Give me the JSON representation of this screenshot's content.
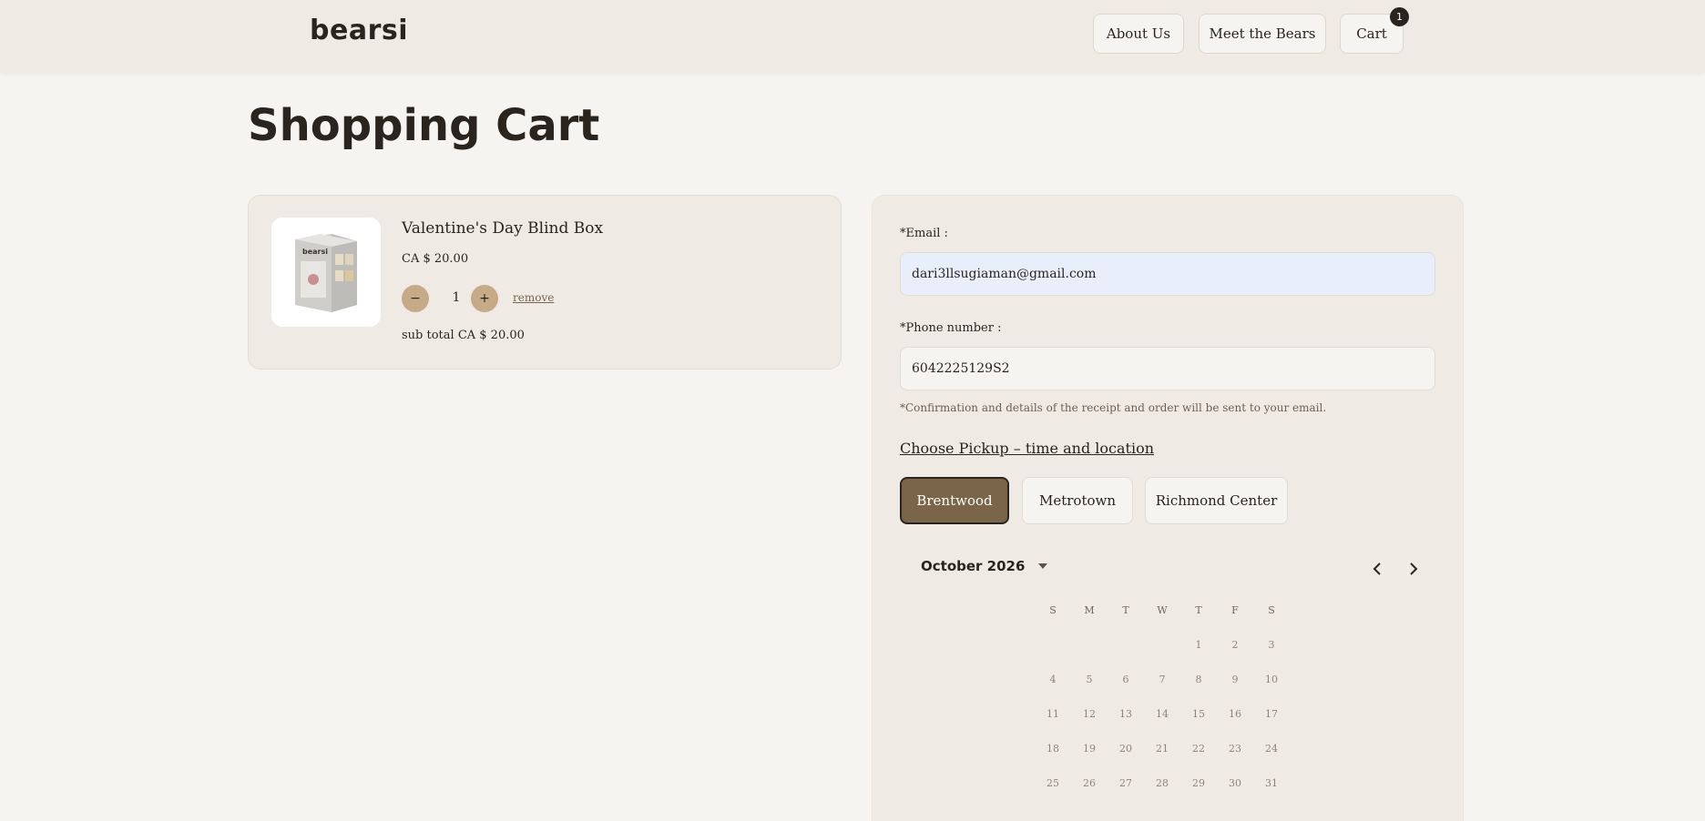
{
  "header": {
    "logo": "bearsi",
    "nav": {
      "about": "About Us",
      "bears": "Meet the Bears",
      "cart": "Cart",
      "cart_count": "1"
    }
  },
  "page": {
    "title": "Shopping Cart"
  },
  "cart": {
    "item": {
      "name": "Valentine's Day Blind Box",
      "price": "CA $ 20.00",
      "quantity": "1",
      "decrement_label": "−",
      "increment_label": "+",
      "remove_label": "remove",
      "subtotal": "sub total CA $ 20.00",
      "image_icon": "blind-box-product-image",
      "box_logo": "bearsi"
    }
  },
  "checkout": {
    "email": {
      "label": "*Email :",
      "value": "dari3llsugiaman@gmail.com"
    },
    "phone": {
      "label": "*Phone number :",
      "value": "6042225129S2"
    },
    "note": "*Confirmation and details of the receipt and order will be sent to your email.",
    "pickup_title": "Choose Pickup – time and location",
    "locations": [
      {
        "label": "Brentwood",
        "selected": true
      },
      {
        "label": "Metrotown",
        "selected": false
      },
      {
        "label": "Richmond Center",
        "selected": false
      }
    ],
    "calendar": {
      "month_label": "October 2026",
      "weekdays": [
        "S",
        "M",
        "T",
        "W",
        "T",
        "F",
        "S"
      ],
      "weeks": [
        [
          "",
          "",
          "",
          "",
          "1",
          "2",
          "3"
        ],
        [
          "4",
          "5",
          "6",
          "7",
          "8",
          "9",
          "10"
        ],
        [
          "11",
          "12",
          "13",
          "14",
          "15",
          "16",
          "17"
        ],
        [
          "18",
          "19",
          "20",
          "21",
          "22",
          "23",
          "24"
        ],
        [
          "25",
          "26",
          "27",
          "28",
          "29",
          "30",
          "31"
        ]
      ]
    }
  },
  "colors": {
    "page_bg": "#f6f4f0",
    "panel_bg": "#efebe4",
    "accent_brown": "#7a6549",
    "qty_button": "#c7ab88",
    "email_fill": "#e8effb"
  }
}
